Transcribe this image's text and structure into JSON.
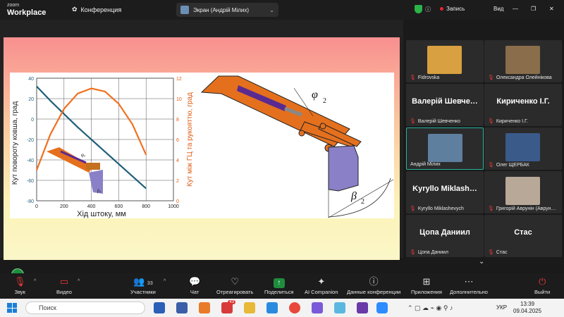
{
  "app": {
    "brand_top": "zoom",
    "brand_bottom": "Workplace",
    "conference_label": "Конференция"
  },
  "share": {
    "title": "Экран (Андрій Мілих)",
    "view_label": "Вид"
  },
  "record": {
    "label": "Запись"
  },
  "slide": {
    "chart_data": {
      "type": "line",
      "x": [
        0,
        100,
        200,
        300,
        400,
        500,
        600,
        700,
        800
      ],
      "xticks": [
        "0",
        "200",
        "400",
        "600",
        "800",
        "1000"
      ],
      "yleft_ticks": [
        "40",
        "20",
        "0",
        "-20",
        "-40",
        "-60",
        "-80"
      ],
      "yright_ticks": [
        "12",
        "10",
        "8",
        "6",
        "4",
        "2",
        "0"
      ],
      "xlabel": "Хід штоку, мм",
      "ylabel_left": "Кут повороту ковша, град",
      "ylabel_right": "Кут між ГЦ та рукояттю, град",
      "xlim": [
        0,
        1000
      ],
      "ylim_left": [
        -80,
        40
      ],
      "ylim_right": [
        0,
        12
      ],
      "series": [
        {
          "axis": "left",
          "color": "#1f5f7a",
          "values": [
            32,
            18,
            5,
            -8,
            -20,
            -32,
            -44,
            -56,
            -68
          ]
        },
        {
          "axis": "right",
          "color": "#f07020",
          "values": [
            3.0,
            6.5,
            9.0,
            10.5,
            11.0,
            10.7,
            9.5,
            7.5,
            4.5
          ]
        }
      ],
      "grid": true
    },
    "diagram": {
      "phi_label": "φ",
      "phi_sub": "2",
      "beta_label": "β",
      "beta_sub": "2",
      "mini_phi": "φ₂",
      "mini_beta": "β₁"
    }
  },
  "participants": [
    {
      "name": "Fidrovska",
      "photo": true,
      "muted": true,
      "color": "#d8a040"
    },
    {
      "name": "Олександра Олейнікова",
      "photo": true,
      "muted": true,
      "color": "#8a6d4a"
    },
    {
      "name": "Валерій Шевченко",
      "big": "Валерій Шевче…",
      "photo": false,
      "muted": true
    },
    {
      "name": "Кириченко І.Г.",
      "big": "Кириченко І.Г.",
      "photo": false,
      "muted": true
    },
    {
      "name": "Андрій Мілих",
      "photo": true,
      "muted": false,
      "active": true,
      "color": "#5f7f9f"
    },
    {
      "name": "Олег ЩЕРБАК",
      "photo": true,
      "muted": true,
      "color": "#3a5a8a"
    },
    {
      "name": "Kyryllo Miklashevych",
      "big": "Kyryllo Miklash…",
      "photo": false,
      "muted": true
    },
    {
      "name": "Григорій Аврунін (Аврун…",
      "photo": true,
      "muted": true,
      "color": "#b8a898"
    },
    {
      "name": "Цопа Даниил",
      "big": "Цопа Даниил",
      "photo": false,
      "muted": true
    },
    {
      "name": "Стас",
      "big": "Стас",
      "photo": false,
      "muted": true
    }
  ],
  "toolbar": {
    "audio": "Звук",
    "video": "Видео",
    "participants": "Участники",
    "participants_count": "33",
    "chat": "Чат",
    "react": "Отреагировать",
    "share": "Поделиться",
    "ai": "AI Companion",
    "info": "Данные конференции",
    "apps": "Приложения",
    "more": "Дополнительно",
    "leave": "Выйти"
  },
  "taskbar": {
    "search": "Поиск",
    "lang": "УКР",
    "time": "13:39",
    "date": "09.04.2025",
    "badge": "43"
  }
}
